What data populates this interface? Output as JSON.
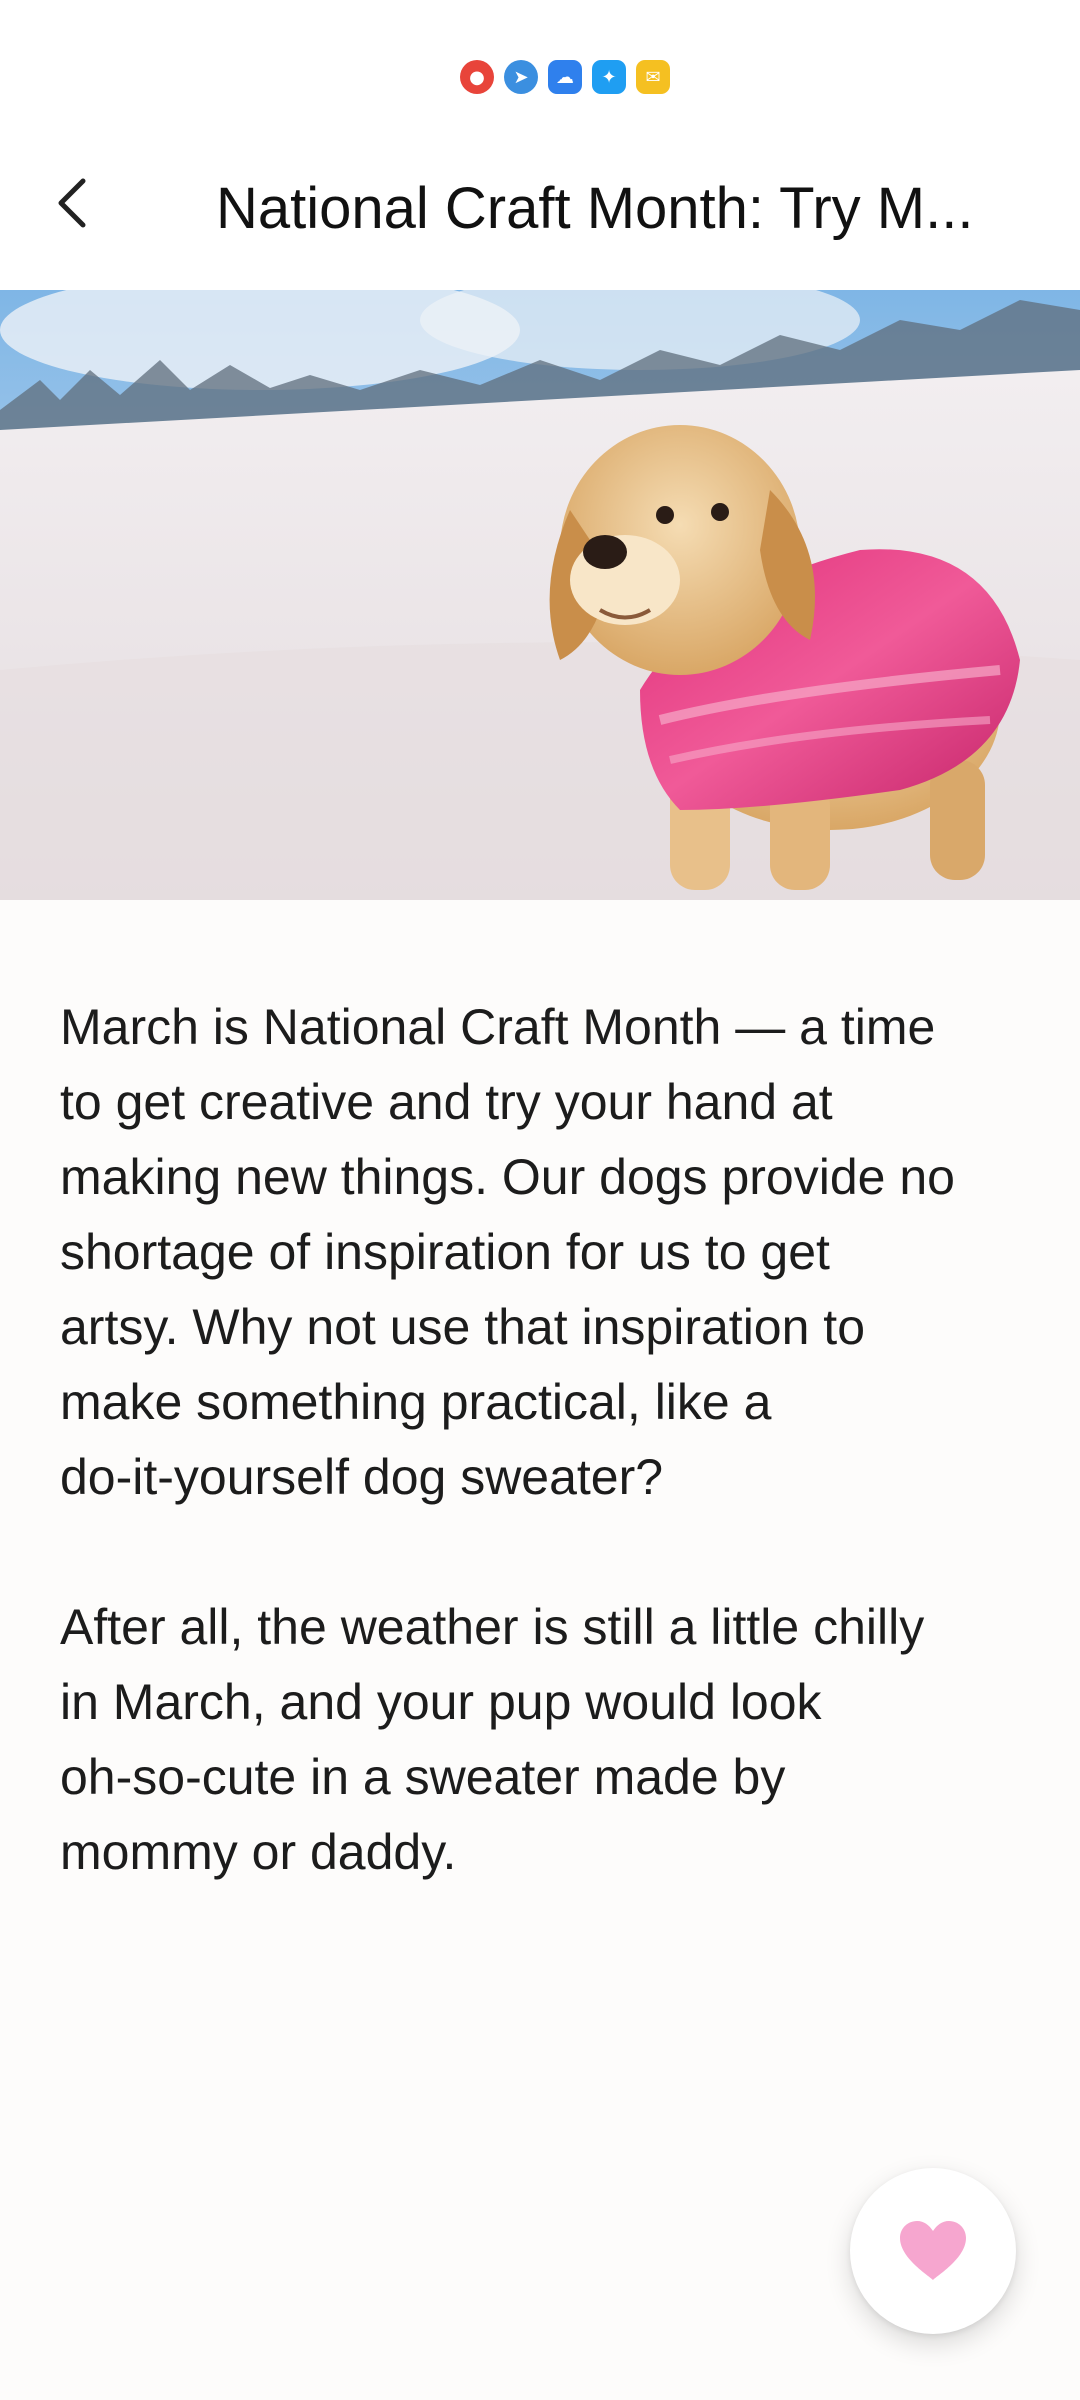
{
  "status_bar": {
    "icons": [
      "app-icon",
      "telegram-icon",
      "cloud-icon",
      "tips-icon",
      "mail-icon"
    ]
  },
  "header": {
    "title": "National Craft Month: Try M...",
    "back_icon": "chevron-left-icon"
  },
  "article": {
    "paragraphs": [
      "March is National Craft Month — a time\nto get creative and try your hand at\nmaking new things. Our dogs provide no\nshortage of inspiration for us to get\nartsy. Why not use that inspiration to\nmake something practical, like a\ndo-it-yourself dog sweater?",
      "After all, the weather is still a little chilly\nin March, and your pup would look\noh-so-cute in a sweater made by\nmommy or daddy."
    ]
  },
  "favorite": {
    "icon": "heart-icon",
    "color": "#f6a6cf"
  },
  "colors": {
    "background": "#fdfcfb",
    "text": "#1c1c1c"
  }
}
